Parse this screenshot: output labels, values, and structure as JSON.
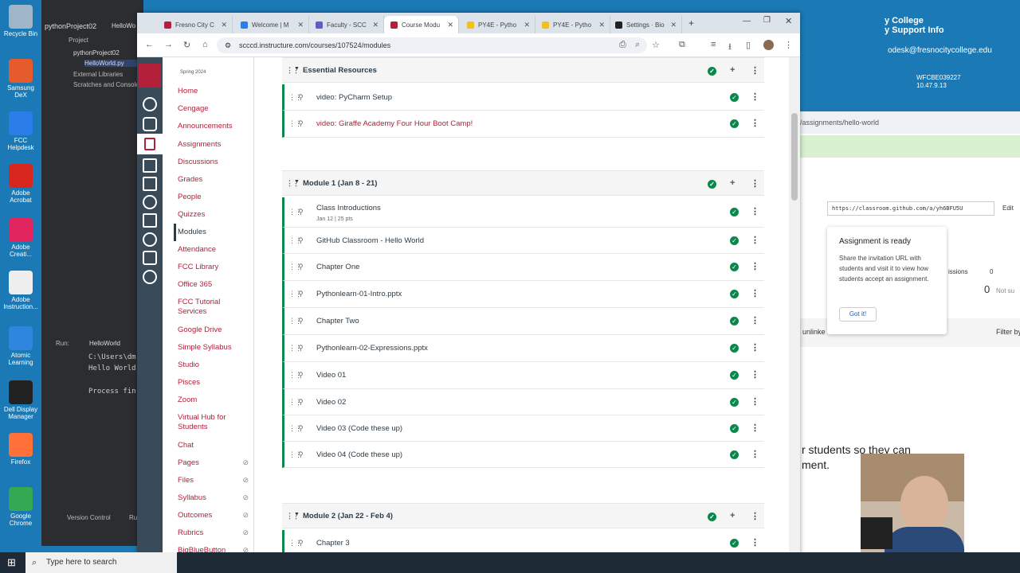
{
  "desktop": {
    "icons": [
      {
        "label": "Recycle Bin",
        "color": "#9fb6c9"
      },
      {
        "label": "Samsung DeX",
        "color": "#e55b2b"
      },
      {
        "label": "FCC Helpdesk",
        "color": "#2b7de9"
      },
      {
        "label": "Adobe Acrobat",
        "color": "#d7261e"
      },
      {
        "label": "Adobe Creati...",
        "color": "#e0245e"
      },
      {
        "label": "Adobe Instruction...",
        "color": "#eeeeee"
      },
      {
        "label": "Atomic Learning",
        "color": "#2e86de"
      },
      {
        "label": "Dell Display Manager",
        "color": "#222222"
      },
      {
        "label": "Firefox",
        "color": "#ff7139"
      },
      {
        "label": "Google Chrome",
        "color": "#34a853"
      }
    ]
  },
  "ide": {
    "project_name": "pythonProject02",
    "tab": "HelloWo",
    "tree_root": "Project",
    "tree_items": [
      "pythonProject02",
      "HelloWorld.py",
      "External Libraries",
      "Scratches and Consoles"
    ],
    "run_label": "Run:",
    "run_config": "HelloWorld",
    "console_lines": [
      "C:\\Users\\dm",
      "Hello World",
      "",
      "Process fin"
    ],
    "version_control": "Version Control",
    "run_tab": "Ru"
  },
  "browser": {
    "tabs": [
      {
        "label": "Fresno City C",
        "color": "#b3203a"
      },
      {
        "label": "Welcome | M",
        "color": "#2b7de9"
      },
      {
        "label": "Faculty - SCC",
        "color": "#5b5fc7"
      },
      {
        "label": "Course Modu",
        "color": "#b3203a"
      },
      {
        "label": "PY4E - Pytho",
        "color": "#f0c020"
      },
      {
        "label": "PY4E - Pytho",
        "color": "#f0c020"
      },
      {
        "label": "Settings · Bio",
        "color": "#222222"
      }
    ],
    "url": "scccd.instructure.com/courses/107524/modules"
  },
  "course_nav": {
    "term": "Spring 2024",
    "items": [
      {
        "label": "Home",
        "hidden": false
      },
      {
        "label": "Cengage",
        "hidden": false
      },
      {
        "label": "Announcements",
        "hidden": false
      },
      {
        "label": "Assignments",
        "hidden": false
      },
      {
        "label": "Discussions",
        "hidden": false
      },
      {
        "label": "Grades",
        "hidden": false
      },
      {
        "label": "People",
        "hidden": false
      },
      {
        "label": "Quizzes",
        "hidden": false
      },
      {
        "label": "Modules",
        "hidden": false,
        "active": true
      },
      {
        "label": "Attendance",
        "hidden": false
      },
      {
        "label": "FCC Library",
        "hidden": false
      },
      {
        "label": "Office 365",
        "hidden": false
      },
      {
        "label": "FCC Tutorial Services",
        "hidden": false
      },
      {
        "label": "Google Drive",
        "hidden": false
      },
      {
        "label": "Simple Syllabus",
        "hidden": false
      },
      {
        "label": "Studio",
        "hidden": false
      },
      {
        "label": "Pisces",
        "hidden": false
      },
      {
        "label": "Zoom",
        "hidden": false
      },
      {
        "label": "Virtual Hub for Students",
        "hidden": false
      },
      {
        "label": "Chat",
        "hidden": false
      },
      {
        "label": "Pages",
        "hidden": true
      },
      {
        "label": "Files",
        "hidden": true
      },
      {
        "label": "Syllabus",
        "hidden": true
      },
      {
        "label": "Outcomes",
        "hidden": true
      },
      {
        "label": "Rubrics",
        "hidden": true
      },
      {
        "label": "BigBlueButton",
        "hidden": true
      }
    ]
  },
  "modules": {
    "essential": {
      "title": "Essential Resources",
      "items": [
        {
          "title": "video: PyCharm Setup",
          "style": "normal"
        },
        {
          "title": "video: Giraffe Academy Four Hour Boot Camp!",
          "style": "link"
        }
      ]
    },
    "module1": {
      "title": "Module 1 (Jan 8 - 21)",
      "items": [
        {
          "title": "Class Introductions",
          "sub": "Jan 12 | 25 pts"
        },
        {
          "title": "GitHub Classroom - Hello World",
          "sub": ""
        },
        {
          "title": "Chapter One",
          "sub": ""
        },
        {
          "title": "Pythonlearn-01-Intro.pptx",
          "sub": ""
        },
        {
          "title": "Chapter Two",
          "sub": ""
        },
        {
          "title": "Pythonlearn-02-Expressions.pptx",
          "sub": ""
        },
        {
          "title": "Video 01",
          "sub": ""
        },
        {
          "title": "Video 02",
          "sub": ""
        },
        {
          "title": "Video 03 (Code these up)",
          "sub": ""
        },
        {
          "title": "Video 04 (Code these up)",
          "sub": ""
        }
      ]
    },
    "module2": {
      "title": "Module 2 (Jan 22 - Feb 4)",
      "items": [
        {
          "title": "Chapter 3",
          "sub": ""
        }
      ]
    }
  },
  "right_window": {
    "header_lines": [
      "y College",
      "y Support Info"
    ],
    "email": "odesk@fresnocitycollege.edu",
    "machine": "WFCBE039227",
    "ip": "10.47.9.13",
    "url_fragment": "/assignments/hello-world",
    "invite_url": "https://classroom.github.com/a/yh6BFU5U",
    "edit": "Edit",
    "popup_title": "Assignment is ready",
    "popup_text": "Share the invitation URL with students and visit it to view how students accept an assignment.",
    "popup_button": "Got it!",
    "submissions_label": "issions",
    "submissions_count": "0",
    "big_zero": "0",
    "not_label": "Not su",
    "unlinked": "unlinke",
    "filter": "Filter by pas",
    "caption_lines": [
      "r students so they can",
      "ment."
    ]
  },
  "taskbar": {
    "search_placeholder": "Type here to search"
  }
}
